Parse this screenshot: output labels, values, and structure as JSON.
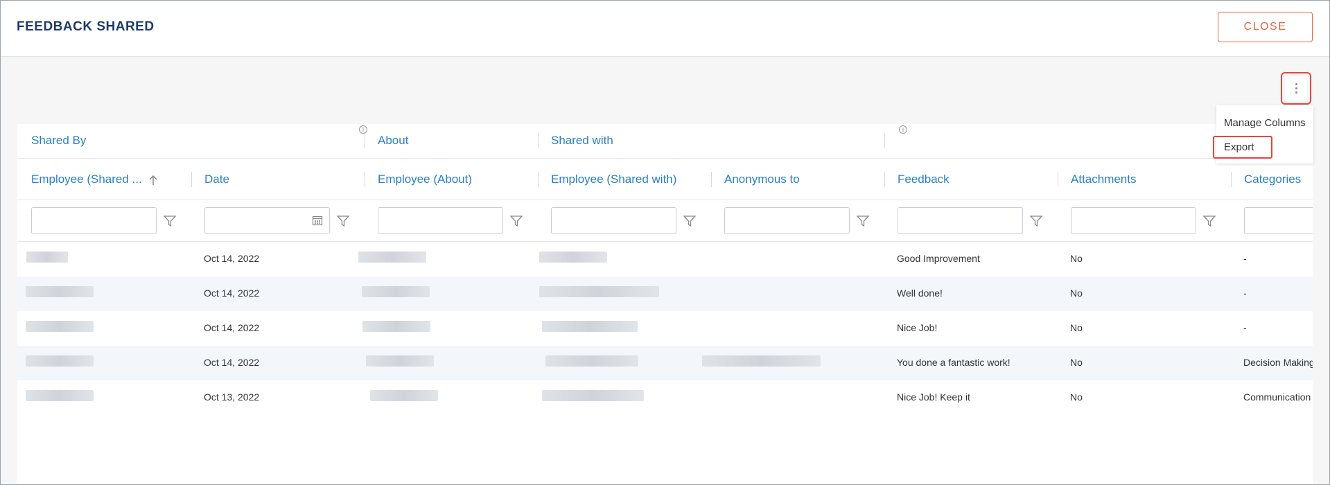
{
  "header": {
    "title": "FEEDBACK SHARED",
    "close_label": "CLOSE"
  },
  "menu": {
    "items": [
      "Manage Columns",
      "Export"
    ]
  },
  "grid": {
    "groups": [
      "Shared By",
      "About",
      "Shared with"
    ],
    "columns": [
      "Employee (Shared ...",
      "Date",
      "Employee (About)",
      "Employee (Shared with)",
      "Anonymous to",
      "Feedback",
      "Attachments",
      "Categories"
    ],
    "rows": [
      {
        "date": "Oct 14, 2022",
        "feedback": "Good Improvement",
        "attachments": "No",
        "categories": "-"
      },
      {
        "date": "Oct 14, 2022",
        "feedback": "Well done!",
        "attachments": "No",
        "categories": "-"
      },
      {
        "date": "Oct 14, 2022",
        "feedback": "Nice Job!",
        "attachments": "No",
        "categories": "-"
      },
      {
        "date": "Oct 14, 2022",
        "feedback": "You done a fantastic work!",
        "attachments": "No",
        "categories": "Decision Making"
      },
      {
        "date": "Oct 13, 2022",
        "feedback": "Nice Job! Keep it",
        "attachments": "No",
        "categories": "Communication"
      }
    ]
  },
  "colors": {
    "accent": "#2a7fc1",
    "title": "#1f3a68",
    "close": "#e8643c",
    "highlight": "#e8453c"
  },
  "icons": [
    "kebab-menu-icon",
    "sort-ascending-icon",
    "filter-icon",
    "calendar-icon",
    "info-icon"
  ]
}
